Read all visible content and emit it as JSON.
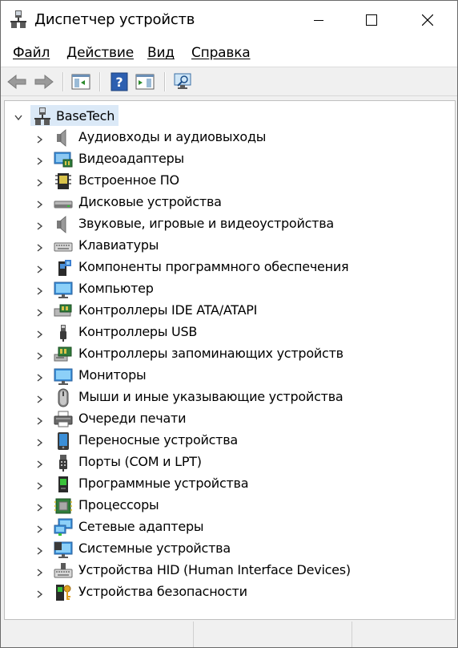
{
  "window": {
    "title": "Диспетчер устройств",
    "colors": {
      "accent": "#0078d7",
      "selection": "#dbe9f7"
    }
  },
  "menubar": {
    "items": [
      {
        "label": "Файл",
        "icon": ""
      },
      {
        "label": "Действие"
      },
      {
        "label": "Вид"
      },
      {
        "label": "Справка"
      }
    ]
  },
  "toolbar": {
    "buttons": [
      {
        "name": "back-button",
        "icon": "arrow-left-icon"
      },
      {
        "name": "forward-button",
        "icon": "arrow-right-icon"
      },
      {
        "name": "show-hide-console-tree-button",
        "icon": "console-tree-icon"
      },
      {
        "name": "help-button",
        "icon": "help-icon"
      },
      {
        "name": "action-pane-button",
        "icon": "action-pane-icon"
      },
      {
        "name": "scan-hardware-button",
        "icon": "monitor-search-icon"
      }
    ]
  },
  "tree": {
    "root": {
      "label": "BaseTech",
      "expanded": true
    },
    "categories": [
      {
        "label": "Аудиовходы и аудиовыходы",
        "icon": "speaker-icon"
      },
      {
        "label": "Видеоадаптеры",
        "icon": "display-adapter-icon"
      },
      {
        "label": "Встроенное ПО",
        "icon": "firmware-chip-icon"
      },
      {
        "label": "Дисковые устройства",
        "icon": "disk-drive-icon"
      },
      {
        "label": "Звуковые, игровые и видеоустройства",
        "icon": "speaker-icon"
      },
      {
        "label": "Клавиатуры",
        "icon": "keyboard-icon"
      },
      {
        "label": "Компоненты программного обеспечения",
        "icon": "software-component-icon"
      },
      {
        "label": "Компьютер",
        "icon": "computer-monitor-icon"
      },
      {
        "label": "Контроллеры IDE ATA/ATAPI",
        "icon": "ide-controller-icon"
      },
      {
        "label": "Контроллеры USB",
        "icon": "usb-plug-icon"
      },
      {
        "label": "Контроллеры запоминающих устройств",
        "icon": "storage-controller-icon"
      },
      {
        "label": "Мониторы",
        "icon": "monitor-icon"
      },
      {
        "label": "Мыши и иные указывающие устройства",
        "icon": "mouse-icon"
      },
      {
        "label": "Очереди печати",
        "icon": "printer-icon"
      },
      {
        "label": "Переносные устройства",
        "icon": "portable-device-icon"
      },
      {
        "label": "Порты (COM и LPT)",
        "icon": "port-icon"
      },
      {
        "label": "Программные устройства",
        "icon": "software-device-icon"
      },
      {
        "label": "Процессоры",
        "icon": "processor-icon"
      },
      {
        "label": "Сетевые адаптеры",
        "icon": "network-adapter-icon"
      },
      {
        "label": "Системные устройства",
        "icon": "system-device-icon"
      },
      {
        "label": "Устройства HID (Human Interface Devices)",
        "icon": "hid-keyboard-icon"
      },
      {
        "label": "Устройства безопасности",
        "icon": "security-key-icon"
      }
    ]
  }
}
